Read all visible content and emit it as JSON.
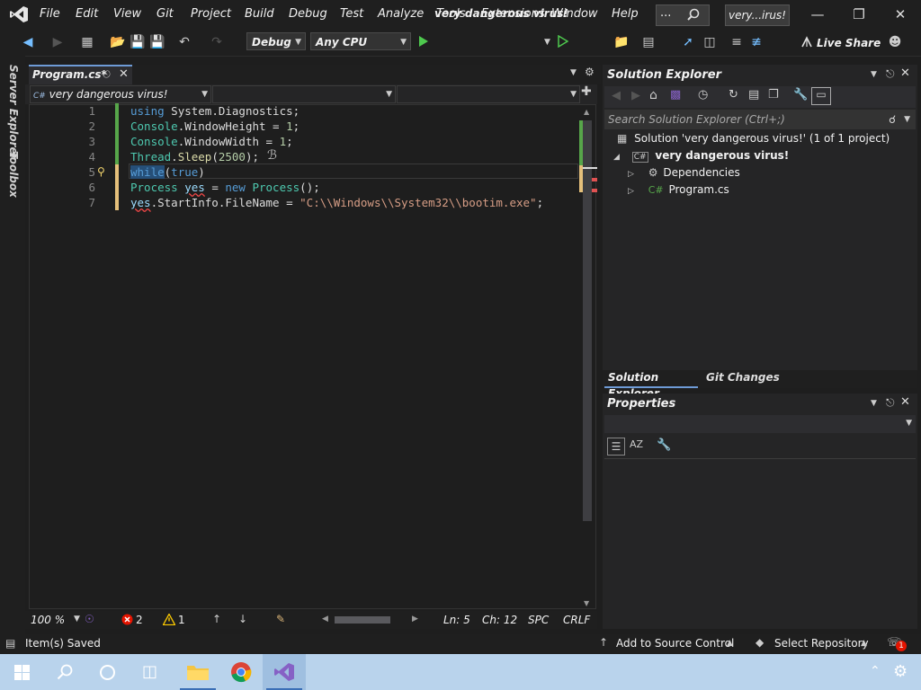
{
  "menu": [
    "File",
    "Edit",
    "View",
    "Git",
    "Project",
    "Build",
    "Debug",
    "Test",
    "Analyze",
    "Tools",
    "Extensions",
    "Window",
    "Help"
  ],
  "search_box": "...",
  "window_title": "very...irus!",
  "toolbar": {
    "config": "Debug",
    "platform": "Any CPU",
    "run_target": "very dangerous virus!",
    "live_share": "Live Share"
  },
  "side_tabs": [
    "Server Explorer",
    "Toolbox"
  ],
  "editor": {
    "tab_title": "Program.cs*",
    "nav_project": "very dangerous virus!",
    "lines": [
      "1",
      "2",
      "3",
      "4",
      "5",
      "6",
      "7"
    ]
  },
  "editor_status": {
    "zoom": "100 %",
    "errors": "2",
    "warnings": "1",
    "line": "Ln: 5",
    "col": "Ch: 12",
    "spc": "SPC",
    "eol": "CRLF"
  },
  "solution_explorer": {
    "title": "Solution Explorer",
    "search_placeholder": "Search Solution Explorer (Ctrl+;)",
    "solution": "Solution 'very dangerous virus!' (1 of 1 project)",
    "project": "very dangerous virus!",
    "dependencies": "Dependencies",
    "file": "Program.cs",
    "tab_se": "Solution Explorer",
    "tab_git": "Git Changes"
  },
  "properties": {
    "title": "Properties"
  },
  "app_status": {
    "saved": "Item(s) Saved",
    "source_control": "Add to Source Control",
    "repo": "Select Repository",
    "notifications": "1"
  },
  "colors": {
    "accent": "#6e9bd6",
    "taskbar": "#b9d3ec",
    "vs_purple": "#8661c5"
  }
}
